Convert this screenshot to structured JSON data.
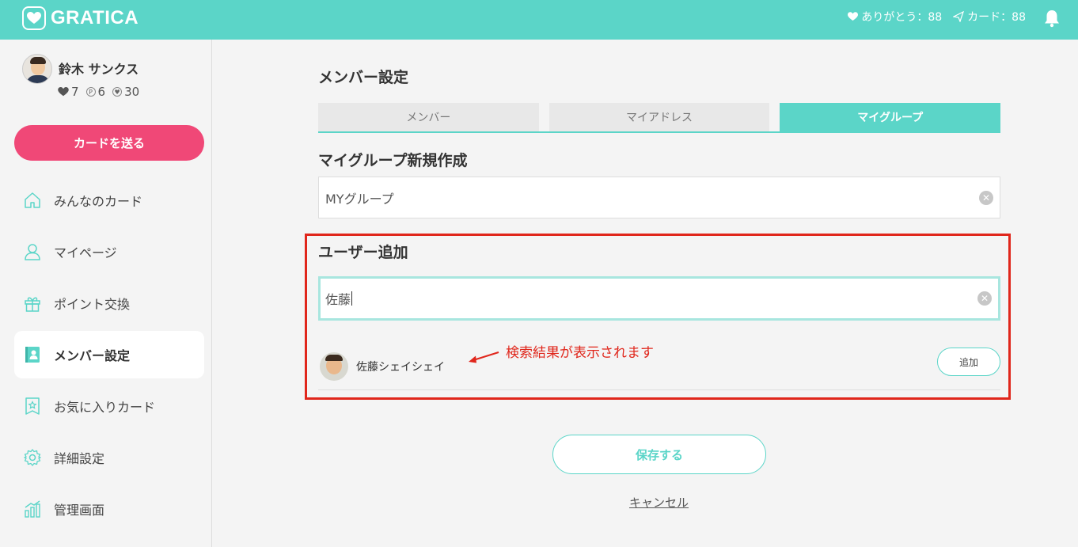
{
  "header": {
    "logo_text": "GRATICA",
    "thanks_label": "ありがとう：88",
    "card_label": "カード：88",
    "bg_color": "#5bd5c8"
  },
  "profile": {
    "name": "鈴木 サンクス",
    "heart_count": "7",
    "point_count": "6",
    "badge_count": "30"
  },
  "sidebar": {
    "send_button": "カードを送る",
    "items": [
      {
        "label": "みんなのカード",
        "icon": "home-icon"
      },
      {
        "label": "マイページ",
        "icon": "user-icon"
      },
      {
        "label": "ポイント交換",
        "icon": "gift-icon"
      },
      {
        "label": "メンバー設定",
        "icon": "member-card-icon",
        "active": true
      },
      {
        "label": "お気に入りカード",
        "icon": "bookmark-star-icon"
      },
      {
        "label": "詳細設定",
        "icon": "gear-icon"
      },
      {
        "label": "管理画面",
        "icon": "chart-icon"
      }
    ]
  },
  "main": {
    "title": "メンバー設定",
    "tabs": [
      {
        "label": "メンバー"
      },
      {
        "label": "マイアドレス"
      },
      {
        "label": "マイグループ",
        "active": true
      }
    ],
    "group_section_title": "マイグループ新規作成",
    "group_name_value": "MYグループ",
    "user_section_title": "ユーザー追加",
    "user_search_value": "佐藤",
    "result_name": "佐藤シェイシェイ",
    "annotation": "検索結果が表示されます",
    "add_button": "追加",
    "save_button": "保存する",
    "cancel_link": "キャンセル"
  },
  "colors": {
    "accent": "#5bd5c8",
    "pink": "#f04877",
    "annotation_red": "#e0261b"
  }
}
